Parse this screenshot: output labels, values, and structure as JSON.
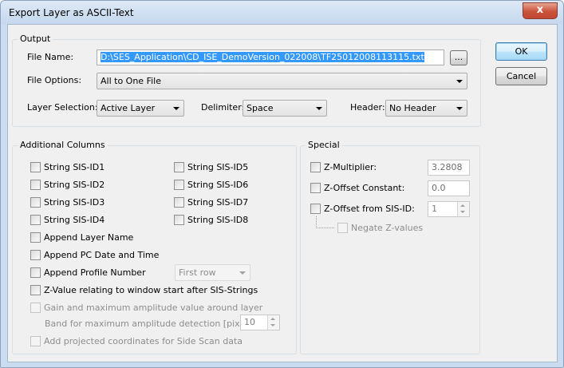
{
  "window": {
    "title": "Export Layer as ASCII-Text",
    "close_glyph": "x"
  },
  "output": {
    "group_title": "Output",
    "file_name_label": "File Name:",
    "file_name_value": "D:\\SES_Application\\CD_ISE_DemoVersion_022008\\TF25012008113115.txt",
    "browse_label": "...",
    "file_options_label": "File Options:",
    "file_options_value": "All to One File",
    "layer_selection_label": "Layer Selection:",
    "layer_selection_value": "Active Layer",
    "delimiter_label": "Delimiter:",
    "delimiter_value": "Space",
    "header_label": "Header:",
    "header_value": "No Header"
  },
  "additional": {
    "group_title": "Additional Columns",
    "string_ids_left": [
      "String SIS-ID1",
      "String SIS-ID2",
      "String SIS-ID3",
      "String SIS-ID4"
    ],
    "string_ids_right": [
      "String SIS-ID5",
      "String SIS-ID6",
      "String SIS-ID7",
      "String SIS-ID8"
    ],
    "append_layer_name": "Append Layer Name",
    "append_pc_date": "Append PC Date and Time",
    "append_profile_number": "Append Profile Number",
    "profile_select_value": "First row",
    "z_value_relating": "Z-Value relating to window start after SIS-Strings",
    "gain_max_amp": "Gain and maximum amplitude value around layer",
    "band_label": "Band for maximum amplitude detection [pixel]:",
    "band_value": "10",
    "add_projected": "Add projected coordinates for Side Scan data"
  },
  "special": {
    "group_title": "Special",
    "z_multiplier_label": "Z-Multiplier:",
    "z_multiplier_value": "3.2808",
    "z_offset_constant_label": "Z-Offset Constant:",
    "z_offset_constant_value": "0.0",
    "z_offset_sis_label": "Z-Offset from SIS-ID:",
    "z_offset_sis_value": "1",
    "negate_z_label": "Negate Z-values"
  },
  "buttons": {
    "ok": "OK",
    "cancel": "Cancel"
  },
  "colors": {
    "selection": "#3399ff",
    "close_button": "#c9523b",
    "title_bar": "#c5d8ee"
  }
}
